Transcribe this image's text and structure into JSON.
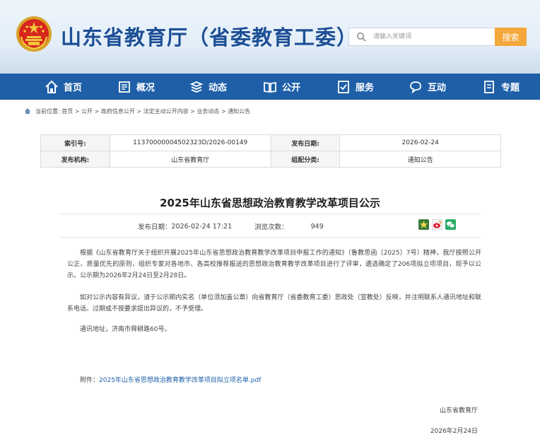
{
  "header": {
    "site_title": "山东省教育厅（省委教育工委）",
    "search_placeholder": "请输入关键词",
    "search_button": "搜索"
  },
  "nav": {
    "items": [
      {
        "label": "首页",
        "icon": "home-icon"
      },
      {
        "label": "概况",
        "icon": "overview-icon"
      },
      {
        "label": "动态",
        "icon": "news-icon"
      },
      {
        "label": "公开",
        "icon": "book-icon"
      },
      {
        "label": "服务",
        "icon": "service-icon"
      },
      {
        "label": "互动",
        "icon": "chat-icon"
      },
      {
        "label": "专题",
        "icon": "topic-icon"
      }
    ]
  },
  "breadcrumb": "当前位置: 首页 > 公开 > 政府信息公开 > 法定主动公开内容 > 业务动态 > 通知公告",
  "meta": {
    "index_label": "索引号:",
    "index_value": "11370000004502323D/2026-00149",
    "publish_date_label": "发布日期:",
    "publish_date_value": "2026-02-24",
    "org_label": "发布机构:",
    "org_value": "山东省教育厅",
    "category_label": "组配分类:",
    "category_value": "通知公告"
  },
  "article": {
    "title": "2025年山东省思想政治教育教学改革项目公示",
    "date_label": "发布日期：",
    "date_value": "2026-02-24 17:21",
    "views_label": "浏览次数：",
    "views_value": "949",
    "paragraphs": [
      "根据《山东省教育厅关于组织开展2025年山东省思想政治教育教学改革项目申报工作的通知》（鲁教思函〔2025〕7号）精神，我厅按照公开公正、质量优先的原则，组织专家对各地市、各高校推荐报送的思想政治教育教学改革项目进行了评审，遴选确定了206项拟立项项目，现予以公示。公示期为2026年2月24日至2月28日。",
      "如对公示内容有异议，请于公示期内实名（单位须加盖公章）向省教育厅（省委教育工委）思政处（宣教处）反映，并注明联系人通讯地址和联系电话。过期或不按要求提出异议的，不予受理。",
      "通讯地址，济南市舜耕路60号。"
    ],
    "attachment_label": "附件：",
    "attachment_link": "2025年山东省思想政治教育教学改革项目拟立项名单.pdf",
    "sign_org": "山东省教育厅",
    "sign_date": "2026年2月24日"
  },
  "colors": {
    "nav_bg": "#1e5fa8",
    "title_blue": "#1d4f95",
    "search_button": "#f4a73a"
  }
}
